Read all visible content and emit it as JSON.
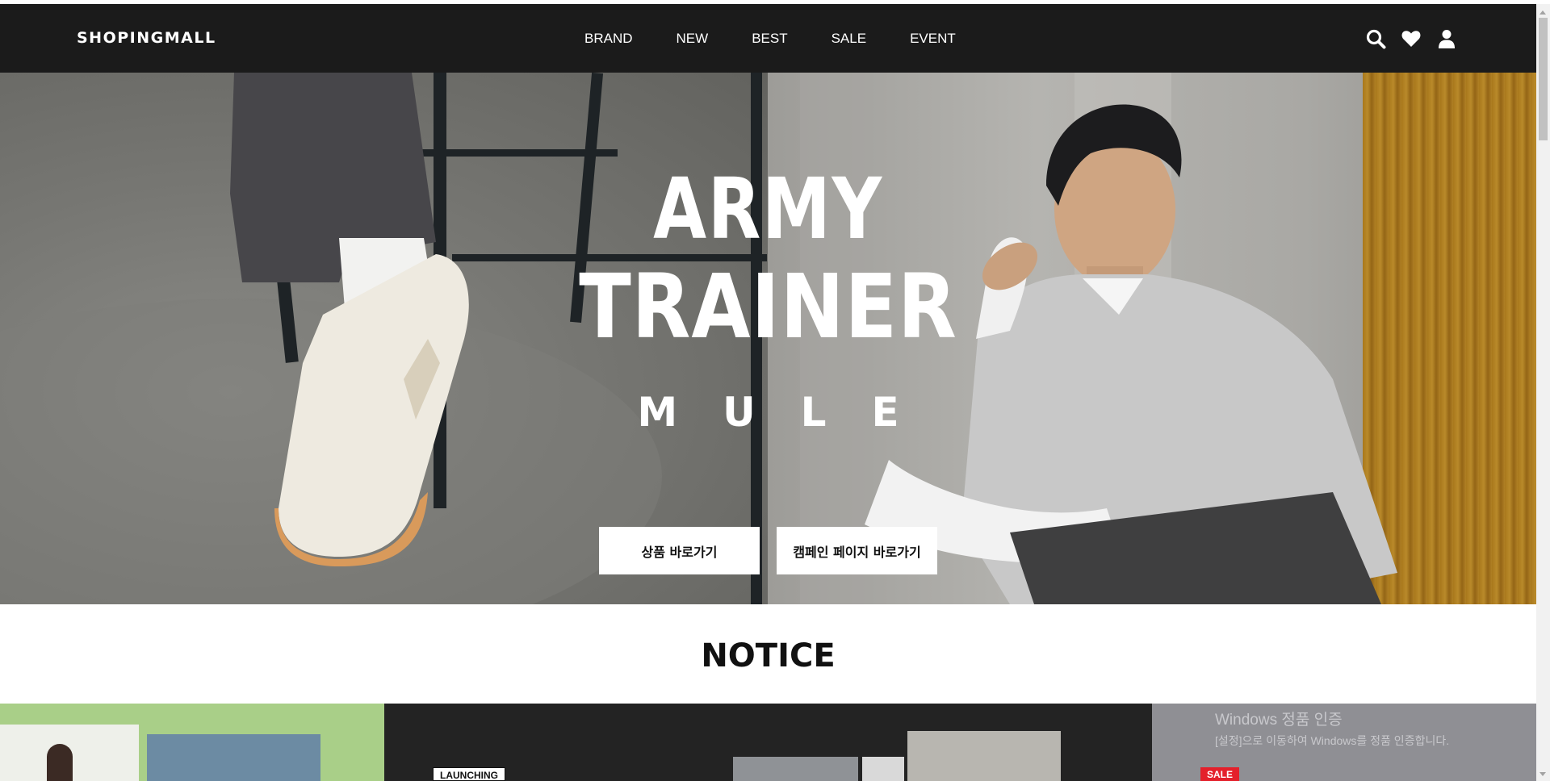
{
  "header": {
    "logo": "SHOPINGMALL",
    "nav": [
      "BRAND",
      "NEW",
      "BEST",
      "SALE",
      "EVENT"
    ],
    "icons": [
      "search-icon",
      "heart-icon",
      "user-icon"
    ]
  },
  "hero": {
    "title_line1": "ARMY",
    "title_line2": "TRAINER",
    "title_line3": "MULE",
    "button_product": "상품 바로가기",
    "button_campaign": "캠페인 페이지 바로가기"
  },
  "notice": {
    "title": "NOTICE",
    "cards": [
      {
        "tag": ""
      },
      {
        "tag": "LAUNCHING"
      },
      {
        "tag": "SALE"
      }
    ]
  },
  "watermark": {
    "line1": "Windows 정품 인증",
    "line2": "[설정]으로 이동하여 Windows를 정품 인증합니다."
  },
  "colors": {
    "header_bg": "#1b1b1b",
    "sale_tag": "#e4202b",
    "card1_bg": "#a9cf88",
    "card2_bg": "#232323",
    "card3_bg": "#8f8f94"
  }
}
